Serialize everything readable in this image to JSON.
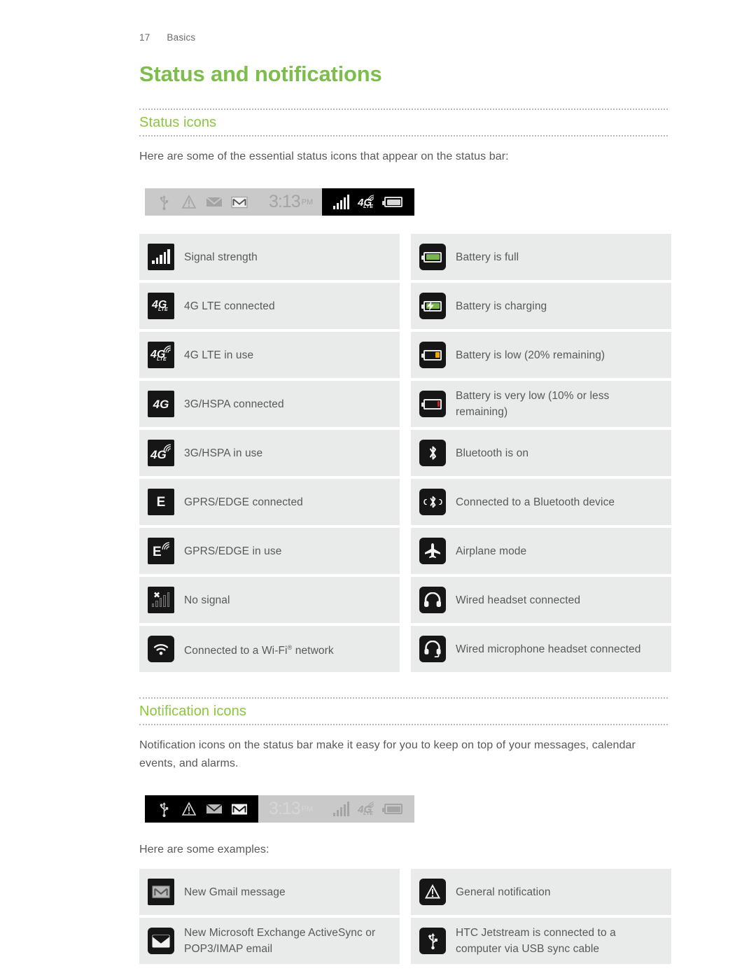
{
  "header": {
    "page_number": "17",
    "section": "Basics"
  },
  "title": "Status and notifications",
  "colors": {
    "accent_green": "#8cc63e",
    "title_green": "#7dbd4c",
    "row_bg": "#e9eaea",
    "icon_dark": "#161616",
    "battery_full": "#7ab648",
    "battery_low": "#f0a500",
    "battery_critical": "#d0202a"
  },
  "sections": {
    "status_icons": {
      "heading": "Status icons",
      "intro": "Here are some of the essential status icons that appear on the status bar:",
      "statusbar": {
        "time": "3:13",
        "ampm": "PM",
        "left_icons": [
          "usb-icon",
          "general-notification-icon",
          "envelope-icon",
          "gmail-icon"
        ],
        "right_icons": [
          "signal-bars-icon",
          "4g-lte-in-use-icon",
          "battery-full-icon"
        ],
        "highlighted_side": "right"
      },
      "left_column": [
        {
          "icon": "signal-bars-icon",
          "label": "Signal strength"
        },
        {
          "icon": "4g-lte-connected-icon",
          "label": "4G LTE connected"
        },
        {
          "icon": "4g-lte-in-use-icon",
          "label": "4G LTE in use"
        },
        {
          "icon": "3g-hspa-connected-icon",
          "label": "3G/HSPA connected"
        },
        {
          "icon": "3g-hspa-in-use-icon",
          "label": "3G/HSPA in use"
        },
        {
          "icon": "gprs-edge-connected-icon",
          "label": "GPRS/EDGE connected"
        },
        {
          "icon": "gprs-edge-in-use-icon",
          "label": "GPRS/EDGE in use"
        },
        {
          "icon": "no-signal-icon",
          "label": "No signal"
        },
        {
          "icon": "wifi-icon",
          "label": "Connected to a Wi-Fi® network"
        }
      ],
      "right_column": [
        {
          "icon": "battery-full-icon",
          "label": "Battery is full"
        },
        {
          "icon": "battery-charging-icon",
          "label": "Battery is charging"
        },
        {
          "icon": "battery-low-icon",
          "label": "Battery is low (20% remaining)"
        },
        {
          "icon": "battery-very-low-icon",
          "label": "Battery is very low (10% or less remaining)"
        },
        {
          "icon": "bluetooth-on-icon",
          "label": "Bluetooth is on"
        },
        {
          "icon": "bluetooth-connected-icon",
          "label": "Connected to a Bluetooth device"
        },
        {
          "icon": "airplane-mode-icon",
          "label": "Airplane mode"
        },
        {
          "icon": "wired-headset-icon",
          "label": "Wired headset connected"
        },
        {
          "icon": "wired-microphone-headset-icon",
          "label": "Wired microphone headset connected"
        }
      ]
    },
    "notification_icons": {
      "heading": "Notification icons",
      "intro": "Notification icons on the status bar make it easy for you to keep on top of your messages, calendar events, and alarms.",
      "statusbar": {
        "time": "3:13",
        "ampm": "PM",
        "highlighted_side": "left"
      },
      "examples_intro": "Here are some examples:",
      "left_column": [
        {
          "icon": "gmail-icon",
          "label": "New Gmail message"
        },
        {
          "icon": "envelope-icon",
          "label": "New Microsoft Exchange ActiveSync or POP3/IMAP email"
        }
      ],
      "right_column": [
        {
          "icon": "general-notification-icon",
          "label": "General notification"
        },
        {
          "icon": "usb-icon",
          "label": "HTC Jetstream is connected to a computer via USB sync cable"
        }
      ]
    }
  }
}
